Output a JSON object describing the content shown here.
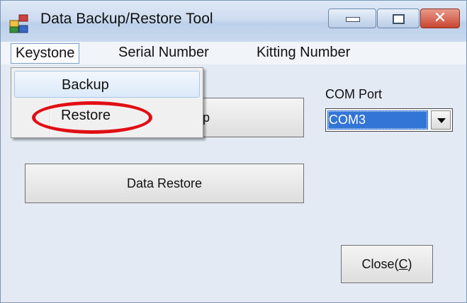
{
  "window": {
    "title": "Data Backup/Restore Tool",
    "icon": "app-icon",
    "controls": {
      "minimize": "minimize-icon",
      "maximize": "maximize-icon",
      "close_glyph": "✕"
    }
  },
  "menubar": {
    "items": [
      {
        "label": "Keystone"
      },
      {
        "label": "Serial Number"
      },
      {
        "label": "Kitting Number"
      }
    ]
  },
  "dropdown": {
    "items": [
      {
        "label": "Backup"
      },
      {
        "label": "Restore"
      }
    ]
  },
  "main": {
    "backup_button_label": "p",
    "restore_button_label": "Data Restore",
    "com_port_label": "COM Port",
    "com_port_value": "COM3",
    "close_button_label": "Close(",
    "close_button_mnemonic": "C",
    "close_button_suffix": ")"
  },
  "colors": {
    "highlight_ring": "#e10f14",
    "selected_combo": "#3375d6",
    "close_button": "#c9452f"
  }
}
